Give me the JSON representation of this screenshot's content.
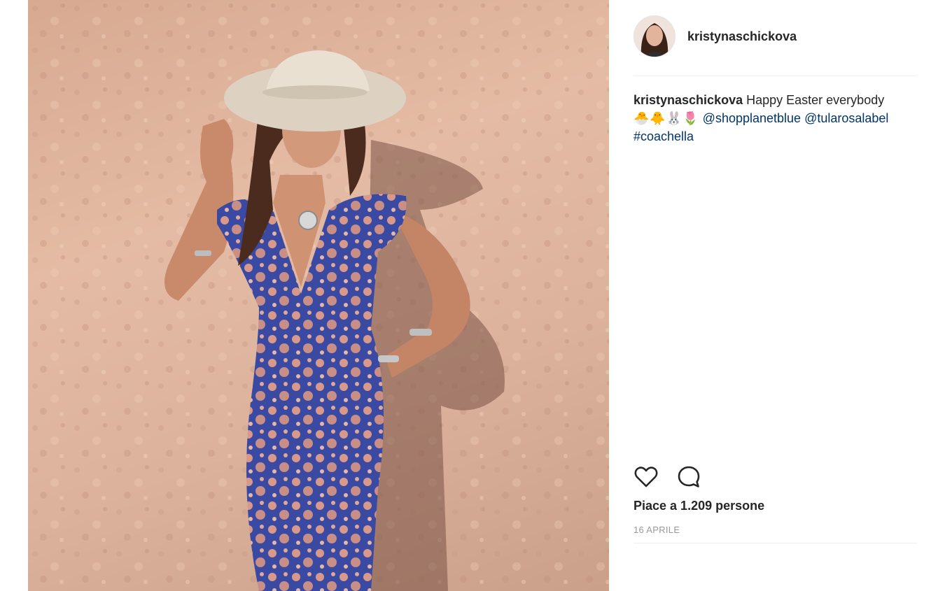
{
  "post": {
    "username": "kristynaschickova",
    "caption": {
      "username": "kristynaschickova",
      "text": "Happy Easter everybody",
      "emojis": "🐣🐥🐰🌷",
      "mention_1": "@shopplanetblue",
      "mention_2": "@tularosalabel",
      "hashtag": "#coachella"
    },
    "likes_text": "Piace a 1.209 persone",
    "date": "16 APRILE"
  },
  "icons": {
    "avatar": "profile-avatar",
    "like": "heart-icon",
    "comment": "comment-bubble-icon"
  },
  "colors": {
    "link": "#003569",
    "text": "#262626",
    "muted": "#999999",
    "divider": "#efefef"
  }
}
